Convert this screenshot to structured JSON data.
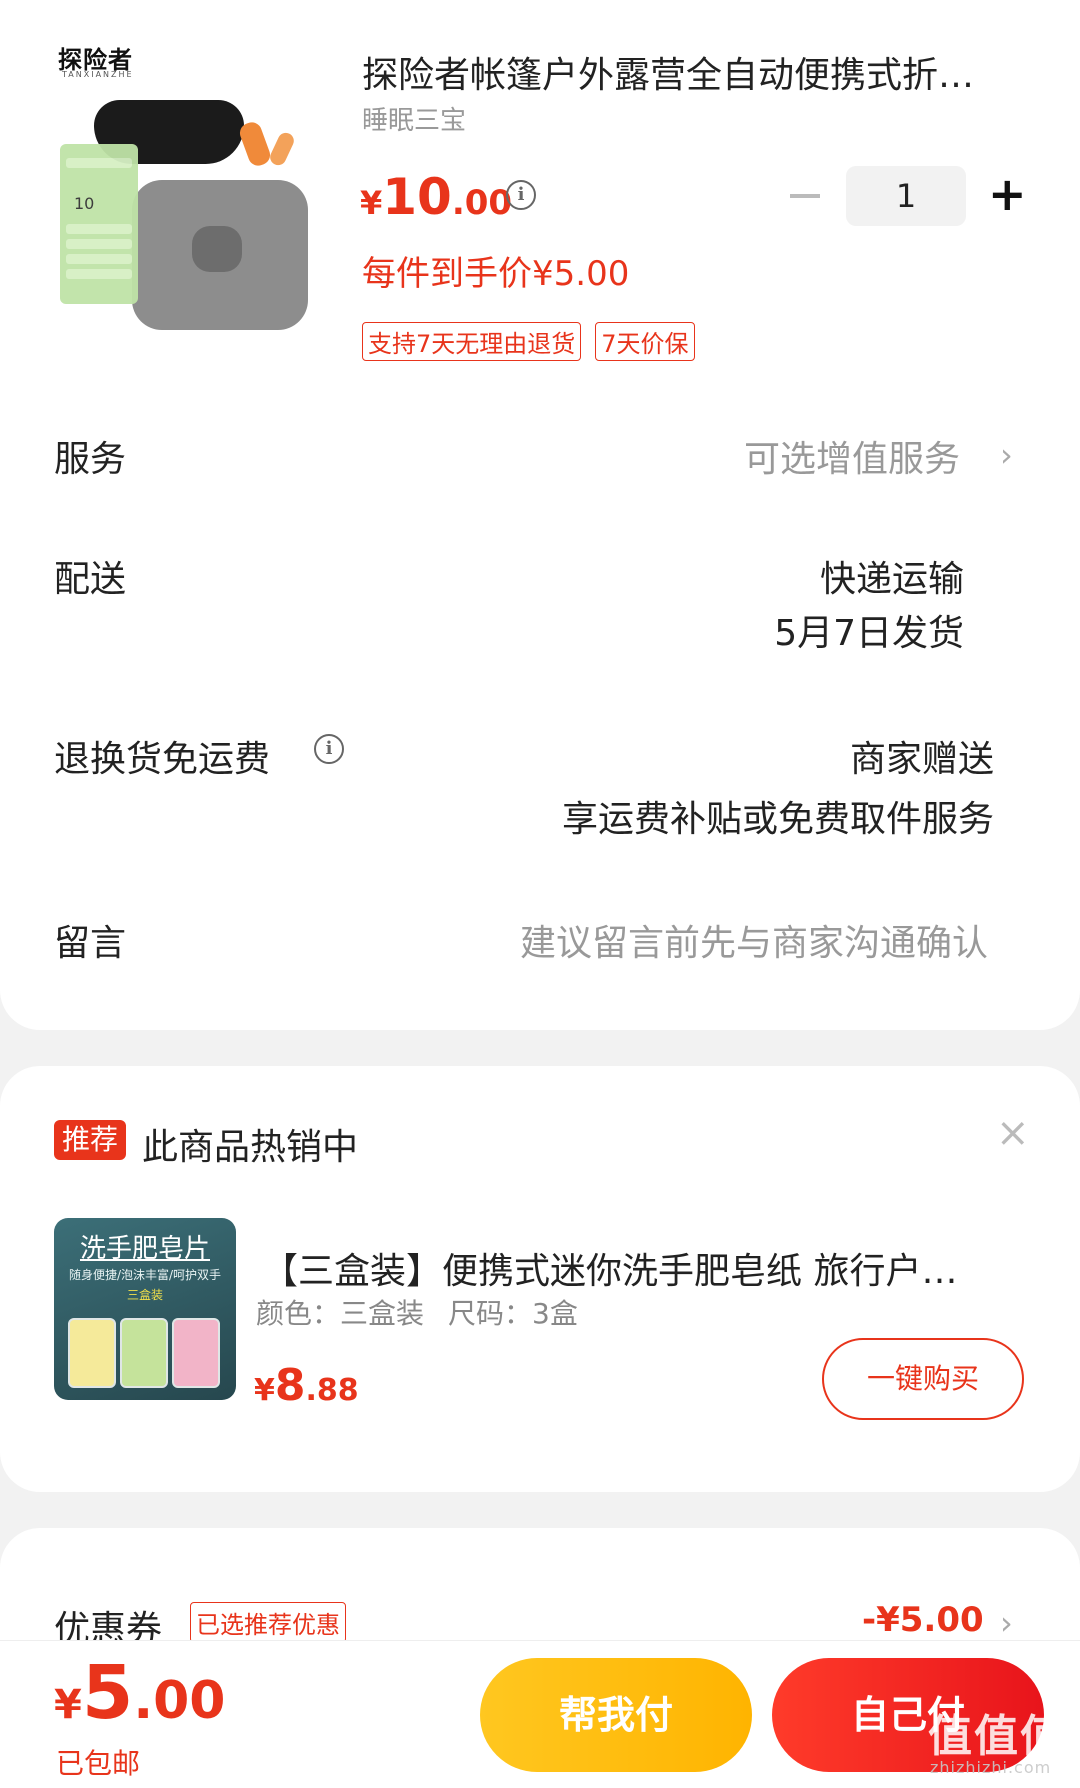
{
  "product": {
    "title": "探险者帐篷户外露营全自动便携式折…",
    "subtitle": "睡眠三宝",
    "price": {
      "yen": "¥",
      "int": "10",
      "dec": ".00"
    },
    "quantity": "1",
    "each_price": "每件到手价¥5.00",
    "tags": [
      "支持7天无理由退货",
      "7天价保"
    ],
    "image": {
      "brand": "探险者",
      "brand_sub": "TANXIANZHE",
      "coupon_value": "10"
    }
  },
  "rows": {
    "service": {
      "label": "服务",
      "value": "可选增值服务"
    },
    "delivery": {
      "label": "配送",
      "line1": "快递运输",
      "line2": "5月7日发货"
    },
    "return_shipping": {
      "label": "退换货免运费",
      "line1": "商家赠送",
      "line2": "享运费补贴或免费取件服务"
    },
    "message": {
      "label": "留言",
      "placeholder": "建议留言前先与商家沟通确认"
    }
  },
  "recommend": {
    "badge": "推荐",
    "title": "此商品热销中",
    "close": "×",
    "item": {
      "name": "【三盒装】便携式迷你洗手肥皂纸 旅行户…",
      "spec_color": "颜色：三盒装",
      "spec_size": "尺码：3盒",
      "price": {
        "yen": "¥",
        "int": "8",
        "dec": ".88"
      },
      "buy_label": "一键购买",
      "image": {
        "title": "洗手肥皂片",
        "line1": "随身便捷/泡沫丰富/呵护双手",
        "line2": "三盒装"
      }
    }
  },
  "coupon": {
    "label": "优惠券",
    "tag": "已选推荐优惠",
    "amount": "-¥5.00"
  },
  "bottom": {
    "total": {
      "yen": "¥",
      "int": "5",
      "dec": ".00"
    },
    "shipping": "已包邮",
    "help_pay": "帮我付",
    "self_pay": "自己付"
  },
  "watermark": {
    "main": "值值值",
    "sub": "zhizhizhi.com"
  },
  "colors": {
    "accent": "#e8341b",
    "help_button": "#ffc720",
    "pay_button": "#ff3b2a"
  }
}
